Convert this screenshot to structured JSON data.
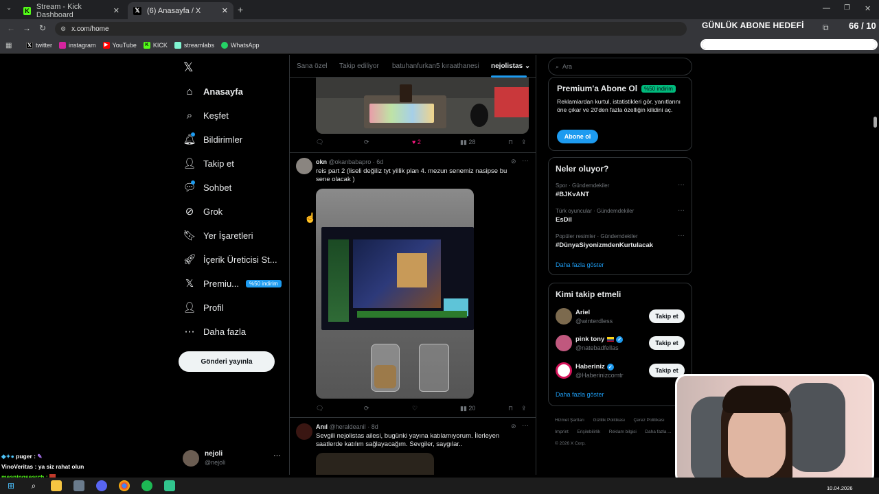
{
  "browser": {
    "tabs": [
      {
        "title": "Stream - Kick Dashboard",
        "active": false
      },
      {
        "title": "(6) Anasayfa / X",
        "active": true
      }
    ],
    "url": "x.com/home",
    "bookmarks": [
      "twitter",
      "instagram",
      "YouTube",
      "KICK",
      "streamlabs",
      "WhatsApp"
    ]
  },
  "overlay": {
    "goal_label": "GÜNLÜK ABONE HEDEFİ",
    "goal_count": "66 / 10",
    "goal_progress": 1.0,
    "chat": [
      {
        "user": "puger :",
        "text": ""
      },
      {
        "user": "VinoVeritas :",
        "text": "ya siz rahat olun"
      },
      {
        "user": "meaningsearch :",
        "text": ""
      }
    ]
  },
  "nav": {
    "items": [
      {
        "label": "Anasayfa",
        "icon": "home-icon",
        "bold": true
      },
      {
        "label": "Keşfet",
        "icon": "search-icon"
      },
      {
        "label": "Bildirimler",
        "icon": "bell-icon"
      },
      {
        "label": "Takip et",
        "icon": "follow-icon"
      },
      {
        "label": "Sohbet",
        "icon": "chat-icon"
      },
      {
        "label": "Grok",
        "icon": "grok-icon"
      },
      {
        "label": "Yer İşaretleri",
        "icon": "bookmark-icon"
      },
      {
        "label": "İçerik Üreticisi St...",
        "icon": "rocket-icon"
      },
      {
        "label": "Premiu...",
        "icon": "x-logo-icon",
        "badge": "%50 indirim"
      },
      {
        "label": "Profil",
        "icon": "person-icon"
      },
      {
        "label": "Daha fazla",
        "icon": "more-circle-icon"
      }
    ],
    "post_button": "Gönderi yayınla",
    "account": {
      "name": "nejoli",
      "handle": "@nejoli"
    }
  },
  "feed": {
    "tabs": [
      "Sana özel",
      "Takip ediliyor",
      "batuhanfurkan5 kıraathanesi",
      "nejolistas"
    ],
    "active_tab": "nejolistas",
    "tweets": [
      {
        "likes": "2",
        "views": "28"
      },
      {
        "name": "okn",
        "handle": "@okanbabapro",
        "time": "· 6d",
        "text": "reis part 2 (liseli değiliz tyt yillik plan 4. mezun senemiz nasipse bu sene olacak )",
        "views": "20"
      },
      {
        "name": "Anıl",
        "handle": "@heraldeanil",
        "time": "· 8d",
        "text": "Sevgili nejolistas ailesi, bugünki yayına katılamıyorum. İlerleyen saatlerde katılım sağlayacağım. Sevgiler, saygılar.."
      }
    ]
  },
  "sidebar": {
    "search_placeholder": "Ara",
    "premium": {
      "title": "Premium'a Abone Ol",
      "badge": "%50 indirim",
      "text": "Reklamlardan kurtul, istatistikleri gör, yanıtlarını öne çıkar ve 20'den fazla özelliğin kilidini aç.",
      "button": "Abone ol"
    },
    "trends_title": "Neler oluyor?",
    "trends": [
      {
        "cat": "Spor · Gündemdekiler",
        "name": "#BJKvANT"
      },
      {
        "cat": "Türk oyuncular · Gündemdekiler",
        "name": "EsDil"
      },
      {
        "cat": "Popüler resimler · Gündemdekiler",
        "name": "#DünyaSiyonizmdenKurtulacak"
      }
    ],
    "trends_more": "Daha fazla göster",
    "follow_title": "Kimi takip etmeli",
    "follow": [
      {
        "name": "Ariel",
        "handle": "@winterdless",
        "button": "Takip et"
      },
      {
        "name": "pink tony",
        "handle": "@natebadfellas",
        "button": "Takip et"
      },
      {
        "name": "Haberiniz",
        "handle": "@Haberinizcomtr",
        "button": "Takip et"
      }
    ],
    "follow_more": "Daha fazla göster",
    "footer": [
      "Hizmet Şartları",
      "Gizlilik Politikası",
      "Çerez Politikası",
      "Imprint",
      "Erişilebilirlik",
      "Reklam bilgisi",
      "Daha fazla ...",
      "© 2026 X Corp."
    ]
  },
  "taskbar": {
    "date": "10.04.2026"
  }
}
